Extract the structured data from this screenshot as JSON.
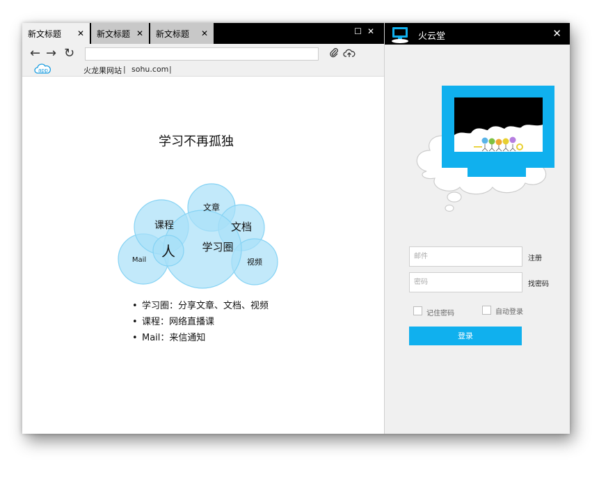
{
  "browser": {
    "tabs": [
      {
        "label": "新文标题",
        "close": "✕"
      },
      {
        "label": "新文标题",
        "close": "✕"
      },
      {
        "label": "新文标题",
        "close": "✕"
      }
    ],
    "window_controls": {
      "maximize": "☐",
      "close": "✕"
    },
    "nav": {
      "back": "←",
      "forward": "→",
      "refresh": "↻"
    },
    "address": "",
    "toolbar_icons": {
      "attach": "attach-icon",
      "upload": "cloud-upload-icon"
    },
    "bookmarks": {
      "app_label": "app",
      "items": [
        "火龙果网站",
        "sohu.com"
      ],
      "separator": "|"
    }
  },
  "page": {
    "title": "学习不再孤独",
    "bubbles": {
      "center": "人",
      "circle": "学习圈",
      "course": "课程",
      "article": "文章",
      "doc": "文档",
      "mail": "Mail",
      "video": "视频"
    },
    "bullets": [
      "学习圈：分享文章、文档、视频",
      "课程：网络直播课",
      "Mail：来信通知"
    ]
  },
  "login": {
    "title": "火云堂",
    "close": "✕",
    "email_placeholder": "邮件",
    "password_placeholder": "密码",
    "register_label": "注册",
    "forgot_label": "找密码",
    "remember_label": "记住密码",
    "auto_login_label": "自动登录",
    "login_button": "登录"
  },
  "colors": {
    "accent": "#10b0ee",
    "bubble": "#a8e0f8",
    "bubble_stroke": "#86d3f4"
  }
}
